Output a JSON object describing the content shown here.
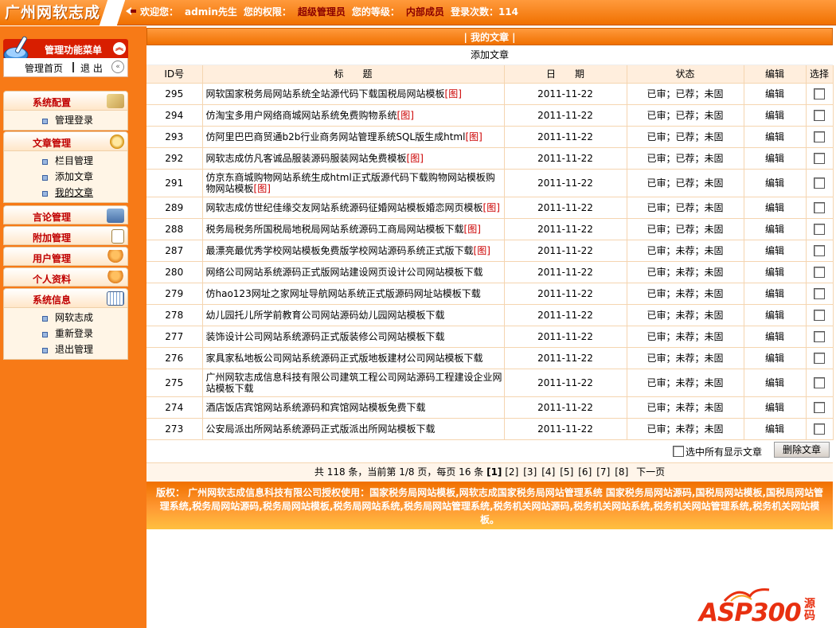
{
  "brand": {
    "logo_text": "广州网软志成"
  },
  "welcome": {
    "label1": "欢迎您：",
    "user": "admin先生",
    "label2": "您的权限：",
    "perm": "超级管理员",
    "label3": "您的等级：",
    "level": "内部成员",
    "label4": "登录次数：",
    "count": "114"
  },
  "sidebar": {
    "menu_title": "管理功能菜单",
    "home": "管理首页",
    "logout": "退 出",
    "sections": [
      {
        "title": "系统配置",
        "items": [
          "管理登录"
        ]
      },
      {
        "title": "文章管理",
        "items": [
          "栏目管理",
          "添加文章",
          "我的文章"
        ]
      },
      {
        "title": "言论管理",
        "items": []
      },
      {
        "title": "附加管理",
        "items": []
      },
      {
        "title": "用户管理",
        "items": []
      },
      {
        "title": "个人资料",
        "items": []
      },
      {
        "title": "系统信息",
        "items": [
          "网软志成",
          "重新登录",
          "退出管理"
        ]
      }
    ]
  },
  "main": {
    "title": "| 我的文章 |",
    "add_article": "添加文章",
    "columns": [
      "ID号",
      "标　　题",
      "日　　期",
      "状态",
      "编辑",
      "选择"
    ],
    "rows": [
      {
        "id": "295",
        "title": "网软国家税务局网站系统全站源代码下载国税局网站模板",
        "img": "[图]",
        "date": "2011-11-22",
        "status": "已审；已荐；未固",
        "edit": "编辑"
      },
      {
        "id": "294",
        "title": "仿淘宝多用户网络商城网站系统免费购物系统",
        "img": "[图]",
        "date": "2011-11-22",
        "status": "已审；已荐；未固",
        "edit": "编辑"
      },
      {
        "id": "293",
        "title": "仿阿里巴巴商贸通b2b行业商务网站管理系统SQL版生成html",
        "img": "[图]",
        "date": "2011-11-22",
        "status": "已审；已荐；未固",
        "edit": "编辑"
      },
      {
        "id": "292",
        "title": "网软志成仿凡客诚品服装源码服装网站免费模板",
        "img": "[图]",
        "date": "2011-11-22",
        "status": "已审；已荐；未固",
        "edit": "编辑"
      },
      {
        "id": "291",
        "title": "仿京东商城购物网站系统生成html正式版源代码下载购物网站模板购物网站模板",
        "img": "[图]",
        "date": "2011-11-22",
        "status": "已审；已荐；未固",
        "edit": "编辑"
      },
      {
        "id": "289",
        "title": "网软志成仿世纪佳缘交友网站系统源码征婚网站模板婚恋网页模板",
        "img": "[图]",
        "date": "2011-11-22",
        "status": "已审；已荐；未固",
        "edit": "编辑"
      },
      {
        "id": "288",
        "title": "税务局税务所国税局地税局网站系统源码工商局网站模板下载",
        "img": "[图]",
        "date": "2011-11-22",
        "status": "已审；已荐；未固",
        "edit": "编辑"
      },
      {
        "id": "287",
        "title": "最漂亮最优秀学校网站模板免费版学校网站源码系统正式版下载",
        "img": "[图]",
        "date": "2011-11-22",
        "status": "已审；未荐；未固",
        "edit": "编辑"
      },
      {
        "id": "280",
        "title": "网络公司网站系统源码正式版网站建设网页设计公司网站模板下载",
        "img": "",
        "date": "2011-11-22",
        "status": "已审；未荐；未固",
        "edit": "编辑"
      },
      {
        "id": "279",
        "title": "仿hao123网址之家网址导航网站系统正式版源码网址站模板下载",
        "img": "",
        "date": "2011-11-22",
        "status": "已审；未荐；未固",
        "edit": "编辑"
      },
      {
        "id": "278",
        "title": "幼儿园托儿所学前教育公司网站源码幼儿园网站模板下载",
        "img": "",
        "date": "2011-11-22",
        "status": "已审；未荐；未固",
        "edit": "编辑"
      },
      {
        "id": "277",
        "title": "装饰设计公司网站系统源码正式版装修公司网站模板下载",
        "img": "",
        "date": "2011-11-22",
        "status": "已审；未荐；未固",
        "edit": "编辑"
      },
      {
        "id": "276",
        "title": "家具家私地板公司网站系统源码正式版地板建材公司网站模板下载",
        "img": "",
        "date": "2011-11-22",
        "status": "已审；未荐；未固",
        "edit": "编辑"
      },
      {
        "id": "275",
        "title": "广州网软志成信息科技有限公司建筑工程公司网站源码工程建设企业网站模板下载",
        "img": "",
        "date": "2011-11-22",
        "status": "已审；未荐；未固",
        "edit": "编辑"
      },
      {
        "id": "274",
        "title": "酒店饭店宾馆网站系统源码和宾馆网站模板免费下载",
        "img": "",
        "date": "2011-11-22",
        "status": "已审；未荐；未固",
        "edit": "编辑"
      },
      {
        "id": "273",
        "title": "公安局派出所网站系统源码正式版派出所网站模板下载",
        "img": "",
        "date": "2011-11-22",
        "status": "已审；未荐；未固",
        "edit": "编辑"
      }
    ],
    "select_all": "选中所有显示文章",
    "delete_btn": "删除文章",
    "pager": {
      "summary": "共 118 条，当前第 1/8 页，每页 16 条",
      "current": "[1]",
      "pages": [
        "[2]",
        "[3]",
        "[4]",
        "[5]",
        "[6]",
        "[7]",
        "[8]"
      ],
      "next": "下一页"
    },
    "footer": "版权： 广州网软志成信息科技有限公司授权使用：国家税务局网站模板,网软志成国家税务局网站管理系统 国家税务局网站源码,国税局网站模板,国税局网站管理系统,税务局网站源码,税务局网站模板,税务局网站系统,税务局网站管理系统,税务机关网站源码,税务机关网站系统,税务机关网站管理系统,税务机关网站模板。"
  },
  "watermark": {
    "text": "ASP300",
    "sub": "源码"
  }
}
